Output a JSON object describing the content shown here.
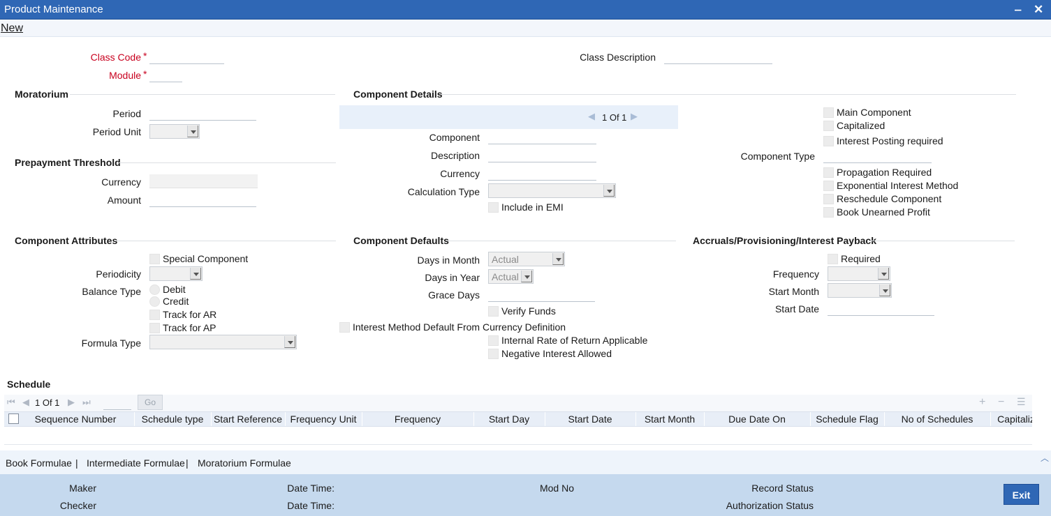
{
  "window": {
    "title": "Product Maintenance",
    "min_icon": "minimize-icon",
    "close_icon": "close-icon"
  },
  "menu": {
    "new_label": "New"
  },
  "header": {
    "class_code_label": "Class Code",
    "module_label": "Module",
    "class_description_label": "Class Description",
    "required_mark": "*"
  },
  "moratorium": {
    "title": "Moratorium",
    "period_label": "Period",
    "period_unit_label": "Period Unit"
  },
  "prepayment": {
    "title": "Prepayment Threshold",
    "currency_label": "Currency",
    "amount_label": "Amount"
  },
  "component_details": {
    "title": "Component Details",
    "pager_text": "1 Of 1",
    "component_label": "Component",
    "description_label": "Description",
    "currency_label": "Currency",
    "calculation_type_label": "Calculation Type",
    "include_in_emi_label": "Include in EMI",
    "main_component_label": "Main Component",
    "capitalized_label": "Capitalized",
    "interest_posting_label": "Interest Posting required",
    "component_type_label": "Component Type",
    "propagation_label": "Propagation Required",
    "exponential_label": "Exponential Interest Method",
    "reschedule_label": "Reschedule Component",
    "book_unearned_label": "Book Unearned Profit"
  },
  "component_attributes": {
    "title": "Component Attributes",
    "special_label": "Special Component",
    "periodicity_label": "Periodicity",
    "balance_type_label": "Balance Type",
    "debit_label": "Debit",
    "credit_label": "Credit",
    "track_ar_label": "Track for AR",
    "track_ap_label": "Track for AP",
    "formula_type_label": "Formula Type"
  },
  "component_defaults": {
    "title": "Component Defaults",
    "days_in_month_label": "Days in Month",
    "days_in_month_value": "Actual",
    "days_in_year_label": "Days in Year",
    "days_in_year_value": "Actual",
    "grace_days_label": "Grace Days",
    "verify_funds_label": "Verify Funds",
    "interest_method_label": "Interest Method Default From Currency Definition",
    "irr_label": "Internal Rate of Return Applicable",
    "negative_interest_label": "Negative Interest Allowed"
  },
  "accruals": {
    "title": "Accruals/Provisioning/Interest Payback",
    "required_label": "Required",
    "frequency_label": "Frequency",
    "start_month_label": "Start Month",
    "start_date_label": "Start Date"
  },
  "schedule": {
    "title": "Schedule",
    "pager_text": "1 Of 1",
    "go_label": "Go",
    "columns": [
      "Sequence Number",
      "Schedule type",
      "Start Reference",
      "Frequency Unit",
      "Frequency",
      "Start Day",
      "Start Date",
      "Start Month",
      "Due Date On",
      "Schedule Flag",
      "No of Schedules",
      "Capitaliz"
    ]
  },
  "links": {
    "book": "Book Formulae",
    "intermediate": "Intermediate Formulae",
    "moratorium": "Moratorium Formulae",
    "separator": "|"
  },
  "footer": {
    "maker_label": "Maker",
    "checker_label": "Checker",
    "date_time_label": "Date Time:",
    "mod_no_label": "Mod No",
    "record_status_label": "Record Status",
    "authorization_status_label": "Authorization Status",
    "exit_label": "Exit"
  },
  "colors": {
    "titlebar": "#2f67b5",
    "required": "#c8001e",
    "footer": "#c5d9ee",
    "exit": "#2f67b5"
  }
}
